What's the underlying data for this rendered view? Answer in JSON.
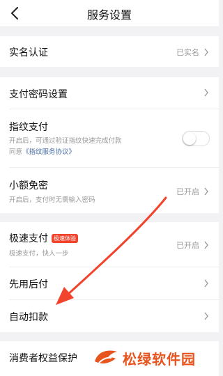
{
  "header": {
    "title": "服务设置"
  },
  "realname": {
    "label": "实名认证",
    "status": "已实名"
  },
  "payment_password": {
    "label": "支付密码设置"
  },
  "fingerprint": {
    "label": "指纹支付",
    "desc": "开启后，可通过验证指纹快速完成付款",
    "agree_prefix": "同意",
    "agreement_link": "《指纹服务协议》",
    "enabled": false
  },
  "small_free": {
    "label": "小额免密",
    "status": "已开启",
    "desc": "开启后，支付时无需输入密码"
  },
  "fast_pay": {
    "label": "极速支付",
    "tag": "极速体验",
    "status": "已开启",
    "desc": "极速支付，快人一步"
  },
  "pay_later": {
    "label": "先用后付"
  },
  "auto_deduct": {
    "label": "自动扣款"
  },
  "consumer_protection": {
    "label": "消费者权益保护"
  },
  "watermark": {
    "text": "松绿软件园"
  },
  "colors": {
    "accent_red": "#f2432c",
    "link_blue": "#4a6fa5",
    "watermark_orange": "#e8541e"
  }
}
